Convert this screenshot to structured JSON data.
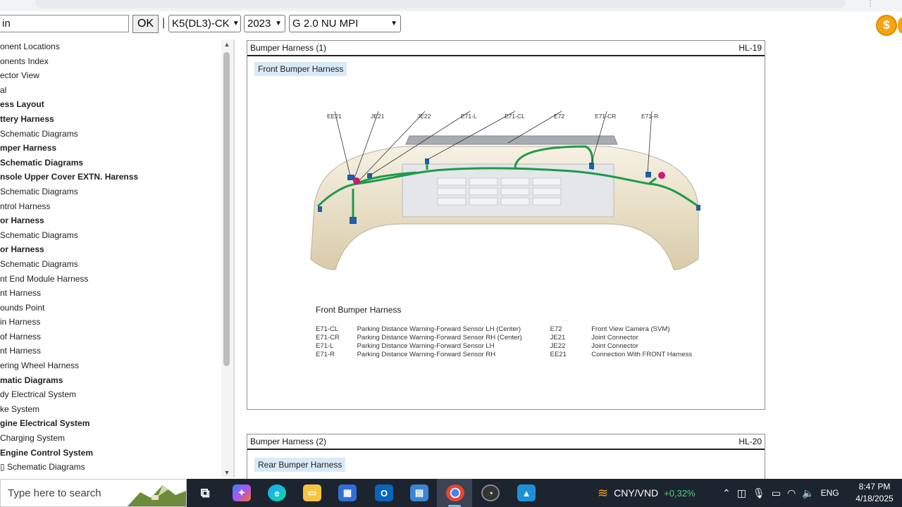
{
  "toolbar": {
    "search_value": "in",
    "ok_label": "OK",
    "separator": "|",
    "model_select": "K5(DL3)-CK",
    "year_select": "2023",
    "engine_select": "G 2.0 NU MPI"
  },
  "sidebar": {
    "items": [
      {
        "label": "onent Locations",
        "bold": false
      },
      {
        "label": "onents Index",
        "bold": false
      },
      {
        "label": "ector View",
        "bold": false
      },
      {
        "label": "al",
        "bold": false
      },
      {
        "label": "ess Layout",
        "bold": true
      },
      {
        "label": "ttery Harness",
        "bold": true
      },
      {
        "label": "Schematic Diagrams",
        "bold": false
      },
      {
        "label": "mper Harness",
        "bold": true
      },
      {
        "label": "Schematic Diagrams",
        "bold": true
      },
      {
        "label": "nsole Upper Cover EXTN. Harenss",
        "bold": true
      },
      {
        "label": "Schematic Diagrams",
        "bold": false
      },
      {
        "label": "ntrol Harness",
        "bold": false
      },
      {
        "label": "or Harness",
        "bold": true
      },
      {
        "label": "Schematic Diagrams",
        "bold": false
      },
      {
        "label": "or Harness",
        "bold": true
      },
      {
        "label": "Schematic Diagrams",
        "bold": false
      },
      {
        "label": "nt End Module Harness",
        "bold": false
      },
      {
        "label": "nt Harness",
        "bold": false
      },
      {
        "label": "ounds Point",
        "bold": false
      },
      {
        "label": "in Harness",
        "bold": false
      },
      {
        "label": "of Harness",
        "bold": false
      },
      {
        "label": "nt Harness",
        "bold": false
      },
      {
        "label": "ering Wheel Harness",
        "bold": false
      },
      {
        "label": "matic Diagrams",
        "bold": true
      },
      {
        "label": "dy Electrical System",
        "bold": false
      },
      {
        "label": "ke System",
        "bold": false
      },
      {
        "label": "gine Electrical System",
        "bold": true
      },
      {
        "label": "Charging System",
        "bold": false
      },
      {
        "label": "Engine Control System",
        "bold": true
      },
      {
        "label": "Schematic Diagrams",
        "bold": false
      }
    ]
  },
  "panel1": {
    "title": "Bumper Harness (1)",
    "code": "HL-19",
    "chip": "Front Bumper Harness",
    "callouts": [
      "EE21",
      "JE21",
      "JE22",
      "E71-L",
      "E71-CL",
      "E72",
      "E71-CR",
      "E71-R"
    ],
    "legend_title": "Front Bumper Harness",
    "legend": [
      {
        "code": "E71-CL",
        "desc": "Parking Distance Warning-Forward Sensor LH (Center)",
        "code2": "E72",
        "desc2": "Front View Camera (SVM)"
      },
      {
        "code": "E71-CR",
        "desc": "Parking Distance Warning-Forward Sensor RH (Center)",
        "code2": "JE21",
        "desc2": "Joint Connector"
      },
      {
        "code": "E71-L",
        "desc": "Parking Distance Warning-Forward Sensor LH",
        "code2": "JE22",
        "desc2": "Joint Connector"
      },
      {
        "code": "E71-R",
        "desc": "Parking Distance Warning-Forward Sensor RH",
        "code2": "EE21",
        "desc2": "Connection With FRONT Harness"
      }
    ]
  },
  "panel2": {
    "title": "Bumper Harness (2)",
    "code": "HL-20",
    "chip": "Rear Bumper Harness"
  },
  "taskbar": {
    "search_placeholder": "Type here to search",
    "ticker_pair": "CNY/VND",
    "ticker_change": "+0,32%",
    "language": "ENG",
    "time": "8:47 PM",
    "date": "4/18/2025"
  },
  "colors": {
    "accent_chip": "#d8e9f7",
    "harness_green": "#1f9a4a",
    "taskbar_bg": "#1c2430",
    "ticker_up": "#46d66e",
    "coin": "#f3a511"
  }
}
